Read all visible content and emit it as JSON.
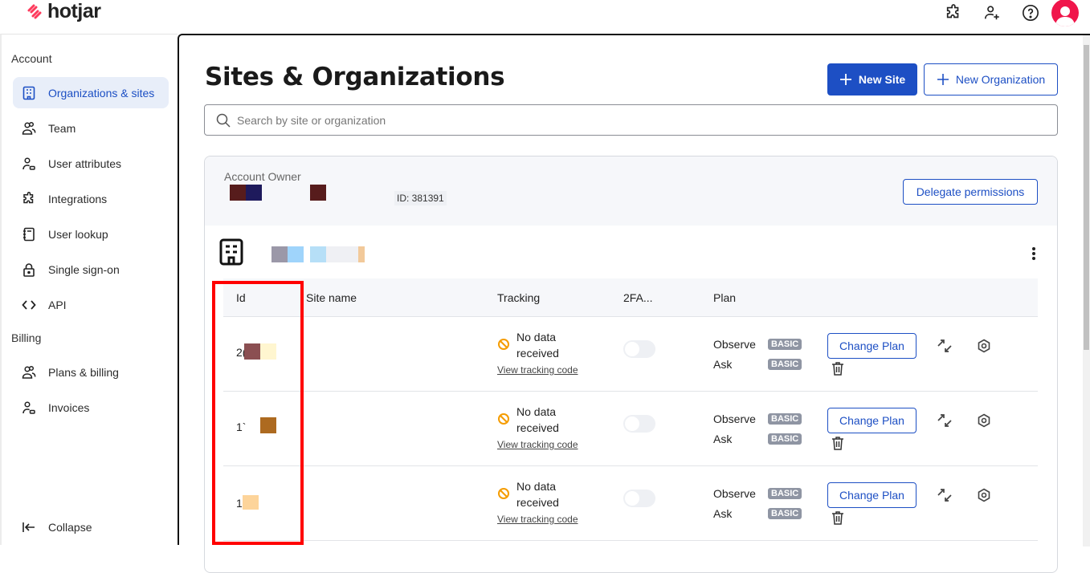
{
  "app": {
    "logo_text": "hotjar",
    "brand_color": "#fd3a5c",
    "accent_color": "#1d4fc4"
  },
  "topbar": {
    "icons": [
      "integrations-icon",
      "invite-user-icon",
      "help-icon",
      "user-avatar"
    ]
  },
  "sidebar": {
    "sections": [
      {
        "label": "Account",
        "items": [
          {
            "label": "Organizations & sites",
            "icon": "building-icon",
            "active": true
          },
          {
            "label": "Team",
            "icon": "team-icon"
          },
          {
            "label": "User attributes",
            "icon": "user-attributes-icon"
          },
          {
            "label": "Integrations",
            "icon": "puzzle-icon"
          },
          {
            "label": "User lookup",
            "icon": "notebook-icon"
          },
          {
            "label": "Single sign-on",
            "icon": "lock-icon"
          },
          {
            "label": "API",
            "icon": "code-icon"
          }
        ]
      },
      {
        "label": "Billing",
        "items": [
          {
            "label": "Plans & billing",
            "icon": "team-icon"
          },
          {
            "label": "Invoices",
            "icon": "user-attributes-icon"
          }
        ]
      }
    ],
    "collapse_label": "Collapse"
  },
  "main": {
    "title": "Sites & Organizations",
    "new_site_label": "New Site",
    "new_org_label": "New Organization",
    "search_placeholder": "Search by site or organization",
    "search_value": "",
    "account": {
      "owner_label": "Account Owner",
      "id_label": "ID: 381391",
      "delegate_label": "Delegate permissions"
    },
    "table": {
      "columns": [
        "Id",
        "Site name",
        "Tracking",
        "2FA...",
        "Plan"
      ],
      "rows": [
        {
          "id_prefix": "2(",
          "site_name": "",
          "tracking_status": "No data received",
          "tracking_line1": "No data",
          "tracking_line2": "received",
          "tracking_link": "View tracking code",
          "twofa_enabled": false,
          "plans": [
            {
              "name": "Observe",
              "tier": "BASIC"
            },
            {
              "name": "Ask",
              "tier": "BASIC"
            }
          ],
          "change_plan_label": "Change Plan"
        },
        {
          "id_prefix": "1`",
          "site_name": "",
          "tracking_status": "No data received",
          "tracking_line1": "No data",
          "tracking_line2": "received",
          "tracking_link": "View tracking code",
          "twofa_enabled": false,
          "plans": [
            {
              "name": "Observe",
              "tier": "BASIC"
            },
            {
              "name": "Ask",
              "tier": "BASIC"
            }
          ],
          "change_plan_label": "Change Plan"
        },
        {
          "id_prefix": "1",
          "site_name": "",
          "tracking_status": "No data received",
          "tracking_line1": "No data",
          "tracking_line2": "received",
          "tracking_link": "View tracking code",
          "twofa_enabled": false,
          "plans": [
            {
              "name": "Observe",
              "tier": "BASIC"
            },
            {
              "name": "Ask",
              "tier": "BASIC"
            }
          ],
          "change_plan_label": "Change Plan"
        }
      ]
    }
  },
  "annotation": {
    "highlight_color": "#ff0000",
    "highlight_target": "Id column"
  }
}
